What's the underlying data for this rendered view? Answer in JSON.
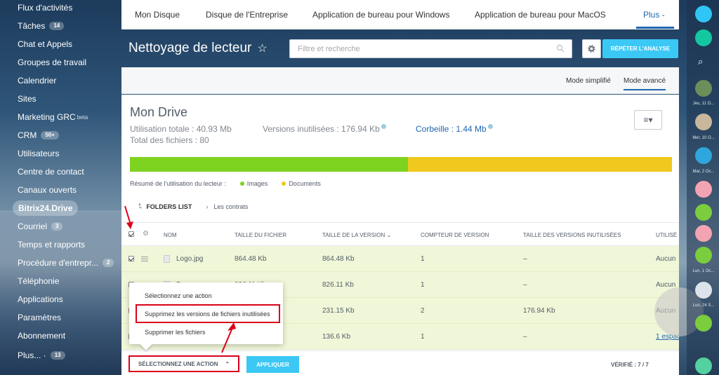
{
  "left_menu": [
    {
      "label": "Flux d'activités"
    },
    {
      "label": "Tâches",
      "badge": "14"
    },
    {
      "label": "Chat et Appels"
    },
    {
      "label": "Groupes de travail"
    },
    {
      "label": "Calendrier"
    },
    {
      "label": "Sites"
    },
    {
      "label": "Marketing GRC",
      "sup": "beta"
    },
    {
      "label": "CRM",
      "badge": "50+"
    },
    {
      "label": "Utilisateurs"
    },
    {
      "label": "Centre de contact"
    },
    {
      "label": "Canaux ouverts"
    },
    {
      "label": "Bitrix24.Drive",
      "active": true
    },
    {
      "label": "Courriel",
      "badge": "3"
    },
    {
      "label": "Temps et rapports"
    },
    {
      "label": "Procédure d'entrepr...",
      "badge": "2"
    },
    {
      "label": "Téléphonie"
    },
    {
      "label": "Applications"
    },
    {
      "label": "Paramètres"
    },
    {
      "label": "Abonnement"
    },
    {
      "label": "Plus... ·",
      "badge": "13"
    }
  ],
  "top_nav": {
    "tabs": [
      "Mon Disque",
      "Disque de l'Entreprise",
      "Application de bureau pour Windows",
      "Application de bureau pour MacOS"
    ],
    "more": "Plus -"
  },
  "header": {
    "title": "Nettoyage de lecteur",
    "star": "☆",
    "search_placeholder": "Filtre et recherche",
    "repeat_button": "RÉPÉTER L'ANALYSE"
  },
  "modes": {
    "simple": "Mode simplifié",
    "advanced": "Mode avancé"
  },
  "drive": {
    "title": "Mon Drive",
    "total_usage": "Utilisation totale : 40.93 Mb",
    "unused_versions": "Versions inutilisées : 176.94 Kb",
    "trash": "Corbeille : 1.44 Mb",
    "total_files": "Total des fichiers : 80",
    "usage_bar": [
      {
        "name": "Images",
        "fraction": 0.513,
        "color": "#7ed321"
      },
      {
        "name": "Documents",
        "fraction": 0.487,
        "color": "#f0c81e"
      }
    ],
    "legend_label": "Résumé de l'utilisation du lecteur :",
    "legend": [
      {
        "name": "Images",
        "color": "#7ed321"
      },
      {
        "name": "Documents",
        "color": "#f0c81e"
      }
    ]
  },
  "breadcrumbs": {
    "root": "FOLDERS LIST",
    "current": "Les contrats"
  },
  "table": {
    "headers": [
      "NOM",
      "TAILLE DU FICHIER",
      "TAILLE DE LA VERSION ⌄",
      "COMPTEUR DE VERSION",
      "TAILLE DES VERSIONS INUTILISÉES",
      "UTILISÉ"
    ],
    "rows": [
      {
        "name": "Logo.jpg",
        "file_size": "864.48 Kb",
        "version_size": "864.48 Kb",
        "version_count": "1",
        "unused": "–",
        "used": "Aucun"
      },
      {
        "name": "Docu...",
        "file_size": "826.11 Kb",
        "version_size": "826.11 Kb",
        "version_count": "1",
        "unused": "–",
        "used": "Aucun"
      },
      {
        "name": "",
        "file_size": "",
        "version_size": "231.15 Kb",
        "version_count": "2",
        "unused": "176.94 Kb",
        "used": "Aucun"
      },
      {
        "name": "Ce design.pdf",
        "file_size": "",
        "version_size": "136.6 Kb",
        "version_count": "1",
        "unused": "–",
        "used": "1 espac"
      }
    ]
  },
  "dropdown": {
    "items": [
      "Sélectionnez une action",
      "Supprimez les versions de fichiers inutilisées",
      "Supprimer les fichiers"
    ]
  },
  "action_bar": {
    "select_label": "SÉLECTIONNEZ UNE ACTION",
    "chevron": "⌃",
    "apply_label": "APPLIQUER",
    "verified": "VÉRIFIÉ : 7 / 7"
  },
  "right_sidebar": {
    "labels": [
      "Jeu, 11 O...",
      "Mer, 10 O...",
      "Mar, 2 Oc...",
      "Lun, 1 Oc...",
      "Lun, 24 S..."
    ]
  },
  "colors": {
    "accent": "#3bc8f5",
    "link": "#2067b0",
    "highlight": "#d9001b",
    "row_selected": "#f0f7d8"
  }
}
